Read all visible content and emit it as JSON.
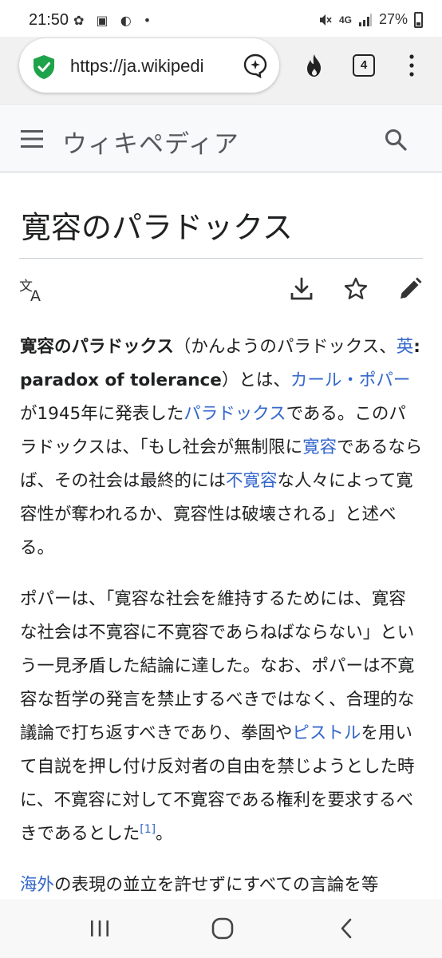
{
  "status_bar": {
    "time": "21:50",
    "left_icons": "✿ ▣ ◐ •",
    "network": "4G",
    "battery": "27%"
  },
  "browser": {
    "url": "https://ja.wikipedi",
    "tab_count": "4"
  },
  "wiki_header": {
    "logo": "ウィキペディア"
  },
  "article": {
    "title": "寛容のパラドックス",
    "p1": {
      "term": "寛容のパラドックス",
      "reading": "（かんようのパラドックス、",
      "lang_link": "英",
      "colon": ": ",
      "english": "paradox of tolerance",
      "after_english": "）とは、",
      "popper_link": "カール・ポパー",
      "mid1": "が1945年に発表した",
      "paradox_link": "パラドックス",
      "mid2": "である。このパラドックスは、「もし社会が無制限に",
      "tolerance_link": "寛容",
      "mid3": "であるならば、その社会は最終的には",
      "intolerance_link": "不寛容",
      "end": "な人々によって寛容性が奪われるか、寛容性は破壊される」と述べる。"
    },
    "p2": {
      "text1": "ポパーは、「寛容な社会を維持するためには、寛容な社会は不寛容に不寛容であらねばならない」という一見矛盾した結論に達した。なお、ポパーは不寛容な哲学の発言を禁止するべきではなく、合理的な議論で打ち返すべきであり、拳固や",
      "pistol_link": "ピストル",
      "text2": "を用いて自説を押し付け反対者の自由を禁じようとした時に、不寛容に対して不寛容である権利を要求するべきであるとした",
      "ref": "[1]",
      "text3": "。"
    },
    "p3_partial": {
      "link": "海外",
      "text": "の表現の並立を許せずにすべての言論を等"
    }
  },
  "colors": {
    "link": "#3366cc",
    "text": "#202122",
    "shield_green": "#1fa34a"
  },
  "icons": [
    "shield-check-icon",
    "assistant-icon",
    "flame-icon",
    "tabs-icon",
    "more-vert-icon",
    "menu-icon",
    "search-icon",
    "language-icon",
    "download-icon",
    "star-icon",
    "edit-icon",
    "recent-apps-icon",
    "home-icon",
    "back-icon"
  ]
}
